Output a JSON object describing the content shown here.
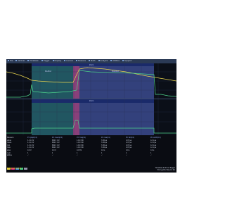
{
  "menu": {
    "items": [
      "File",
      "Vertical",
      "Timebase",
      "Trigger",
      "Display",
      "Cursors",
      "Measure",
      "Math",
      "Analysis",
      "Utilities",
      "Support"
    ]
  },
  "top_panel": {
    "zone_left_label": "Pre-Mod",
    "zone_right_label": "Post-Mod",
    "header_label": "Zoom"
  },
  "bottom_panel": {
    "header_label": "Zoom"
  },
  "table": {
    "row_labels": [
      "Measure",
      "value",
      "mean",
      "min",
      "max",
      "sdev",
      "num",
      "status"
    ],
    "columns": [
      {
        "header": "P1: pkpk(C1)",
        "values": [
          "1.11 mV",
          "1.11 mV",
          "1.11 mV",
          "1.11 mV",
          "0.0 V",
          "1",
          "✓"
        ]
      },
      {
        "header": "P2: mean(C1)",
        "values": [
          "681.3 mV",
          "681.3 mV",
          "681.3 mV",
          "681.3 mV",
          "0.0 V",
          "1",
          "✓"
        ]
      },
      {
        "header": "P3: freq(C1)",
        "values": [
          "1.10 kHz",
          "1.10 kHz",
          "1.10 kHz",
          "1.10 kHz",
          "0.0 Hz",
          "1",
          "✓"
        ]
      },
      {
        "header": "P4: rise(C1)",
        "values": [
          "3.36 µs",
          "3.36 µs",
          "3.36 µs",
          "3.36 µs",
          "0.0 s",
          "1",
          "✓"
        ]
      },
      {
        "header": "P5: fall(C1)",
        "values": [
          "2.47 µs",
          "2.47 µs",
          "2.47 µs",
          "2.47 µs",
          "0.0 s",
          "1",
          "✓"
        ]
      },
      {
        "header": "P6: width(C1)",
        "values": [
          "12.1 µs",
          "12.1 µs",
          "12.1 µs",
          "12.1 µs",
          "0.0 s",
          "1",
          "✓"
        ]
      }
    ]
  },
  "status": {
    "tags": [
      "C1",
      "C2",
      "C3",
      "C4",
      "Z1"
    ],
    "right_lines": [
      "Timebase 0.00 ms  Trigger",
      "50.0 µs/div  Stop  C1 DC"
    ],
    "brand": "TELEDYNE LECROY"
  },
  "colors": {
    "trace_yellow": "#e8d44d",
    "trace_green": "#4dd28a",
    "zone_teal": "#2a8e8e",
    "zone_blue": "#3b4fa8",
    "marker_magenta": "#e0308f"
  }
}
